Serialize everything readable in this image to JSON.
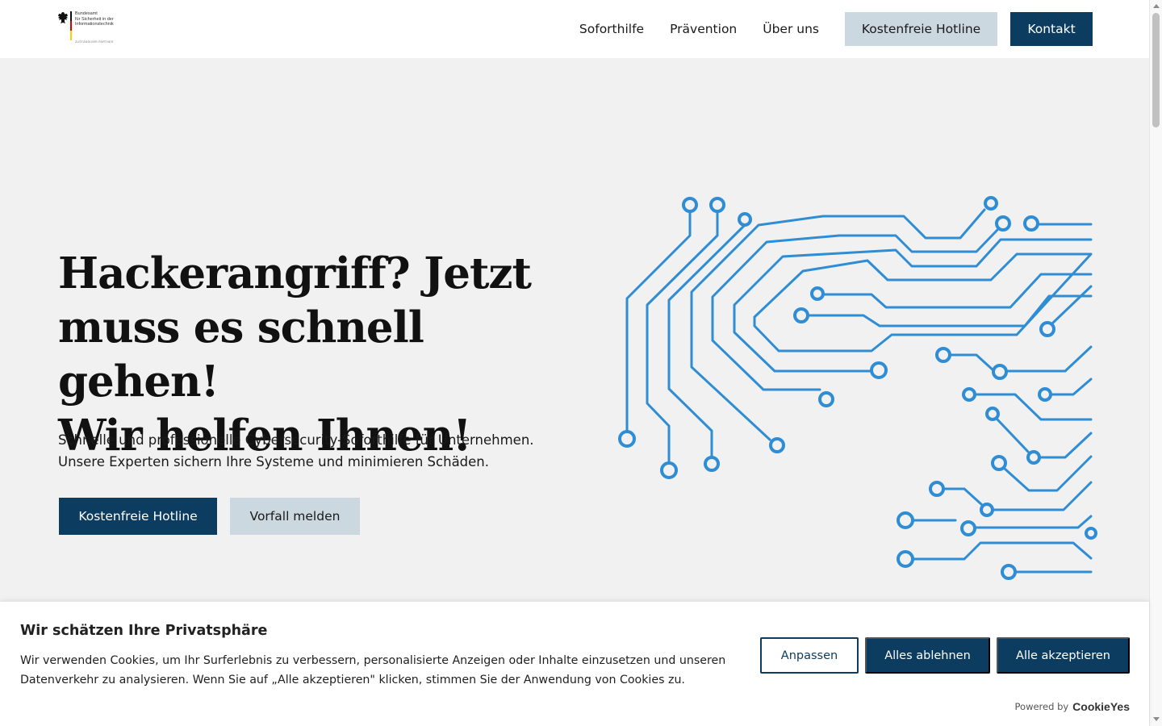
{
  "header": {
    "logo": {
      "lines": [
        "Bundesamt",
        "für Sicherheit in der",
        "Informationstechnik"
      ],
      "partner": "ZUSTÄNDIGER PARTNER"
    },
    "nav": [
      {
        "label": "Soforthilfe"
      },
      {
        "label": "Prävention"
      },
      {
        "label": "Über uns"
      }
    ],
    "hotline_label": "Kostenfreie Hotline",
    "contact_label": "Kontakt"
  },
  "hero": {
    "title_lines": [
      "Hackerangriff? Jetzt",
      "muss es schnell gehen!",
      "Wir helfen Ihnen!"
    ],
    "subtitle_lines": [
      "Schnelle und professionelle Cybersecurity-Soforthilfe für Unternehmen.",
      "Unsere Experten sichern Ihre Systeme und minimieren Schäden."
    ],
    "primary_button": "Kostenfreie Hotline",
    "secondary_button": "Vorfall melden"
  },
  "cookie_banner": {
    "title": "Wir schätzen Ihre Privatsphäre",
    "text": "Wir verwenden Cookies, um Ihr Surferlebnis zu verbessern, personalisierte Anzeigen oder Inhalte einzusetzen und unseren Datenverkehr zu analysieren. Wenn Sie auf „Alle akzeptieren\" klicken, stimmen Sie der Anwendung von Cookies zu.",
    "customize_label": "Anpassen",
    "reject_label": "Alles ablehnen",
    "accept_label": "Alle akzeptieren",
    "powered_by": "Powered by",
    "brand": "CookieYes"
  },
  "colors": {
    "primary": "#0d3c61",
    "secondary": "#ccd8e0",
    "circuit": "#2e8dd4",
    "hero_bg": "#f1f1f1"
  }
}
